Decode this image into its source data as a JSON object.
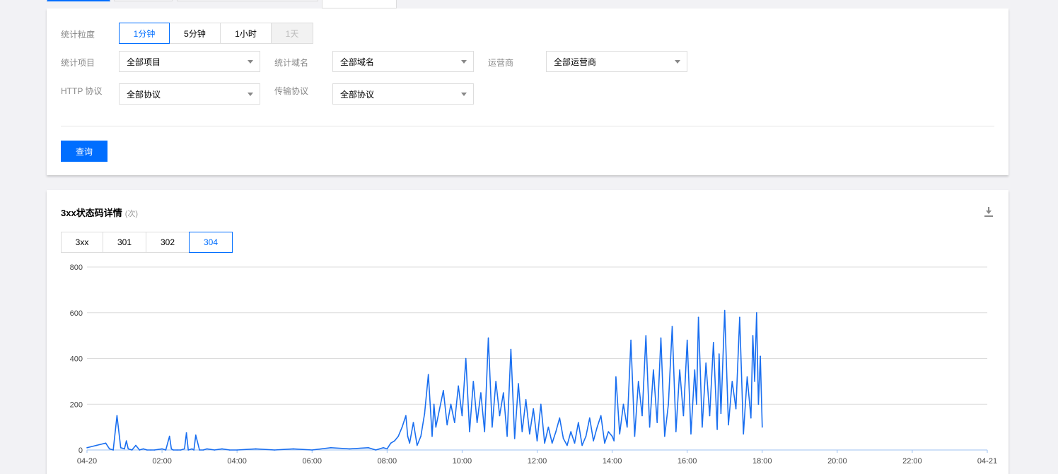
{
  "filters": {
    "granularity": {
      "label": "统计粒度",
      "options": [
        "1分钟",
        "5分钟",
        "1小时",
        "1天"
      ],
      "selected": "1分钟",
      "disabled": "1天"
    },
    "project": {
      "label": "统计项目",
      "value": "全部项目"
    },
    "domain": {
      "label": "统计域名",
      "value": "全部域名"
    },
    "isp": {
      "label": "运营商",
      "value": "全部运营商"
    },
    "http_protocol": {
      "label": "HTTP 协议",
      "value": "全部协议"
    },
    "transport_protocol": {
      "label": "传输协议",
      "value": "全部协议"
    },
    "query_button": "查询"
  },
  "chart_panel": {
    "title": "3xx状态码详情",
    "unit": "(次)",
    "tabs": [
      "3xx",
      "301",
      "302",
      "304"
    ],
    "active_tab": "304",
    "download_icon": "download-icon"
  },
  "colors": {
    "accent": "#006eff",
    "series": "#1a6ff0"
  },
  "chart_data": {
    "type": "line",
    "title": "3xx状态码详情",
    "xlabel": "",
    "ylabel": "",
    "ylim": [
      0,
      800
    ],
    "yticks": [
      "0",
      "200",
      "400",
      "600",
      "800"
    ],
    "xlim_hours": [
      0,
      24
    ],
    "xticks": [
      "04-20",
      "02:00",
      "04:00",
      "06:00",
      "08:00",
      "10:00",
      "12:00",
      "14:00",
      "16:00",
      "18:00",
      "20:00",
      "22:00",
      "04-21"
    ],
    "grid": true,
    "legend": "none",
    "series": [
      {
        "x_hours": [
          0.0,
          0.25,
          0.5,
          0.6,
          0.7,
          0.8,
          0.9,
          1.0,
          1.05,
          1.1,
          1.2,
          1.3,
          1.4,
          1.5,
          1.6,
          1.7,
          1.8,
          2.0,
          2.1,
          2.2,
          2.25,
          2.3,
          2.4,
          2.5,
          2.6,
          2.65,
          2.7,
          2.8,
          2.85,
          2.9,
          3.0,
          3.1,
          3.2,
          3.4,
          3.6,
          3.8,
          4.0,
          4.5,
          5.0,
          5.5,
          6.0,
          6.5,
          7.0,
          7.5,
          7.7,
          7.9,
          8.0,
          8.1,
          8.2,
          8.3,
          8.4,
          8.5,
          8.55,
          8.6,
          8.7,
          8.8,
          8.9,
          9.0,
          9.1,
          9.2,
          9.25,
          9.3,
          9.4,
          9.5,
          9.6,
          9.7,
          9.8,
          9.9,
          10.0,
          10.1,
          10.2,
          10.3,
          10.4,
          10.5,
          10.6,
          10.7,
          10.8,
          10.9,
          11.0,
          11.1,
          11.2,
          11.3,
          11.4,
          11.5,
          11.6,
          11.7,
          11.8,
          11.9,
          12.0,
          12.1,
          12.2,
          12.3,
          12.4,
          12.5,
          12.6,
          12.7,
          12.8,
          12.9,
          13.0,
          13.1,
          13.2,
          13.3,
          13.4,
          13.5,
          13.6,
          13.7,
          13.8,
          13.9,
          14.0,
          14.05,
          14.1,
          14.2,
          14.3,
          14.4,
          14.5,
          14.6,
          14.7,
          14.8,
          14.9,
          15.0,
          15.1,
          15.2,
          15.3,
          15.4,
          15.5,
          15.6,
          15.7,
          15.8,
          15.9,
          16.0,
          16.1,
          16.2,
          16.25,
          16.3,
          16.4,
          16.5,
          16.6,
          16.7,
          16.8,
          16.85,
          16.9,
          17.0,
          17.1,
          17.2,
          17.3,
          17.4,
          17.5,
          17.6,
          17.7,
          17.75,
          17.8,
          17.85,
          17.9,
          17.95,
          18.0
        ],
        "values": [
          10,
          20,
          30,
          5,
          0,
          150,
          10,
          5,
          40,
          5,
          0,
          20,
          0,
          5,
          0,
          0,
          0,
          5,
          0,
          60,
          5,
          0,
          0,
          0,
          5,
          75,
          0,
          5,
          0,
          65,
          0,
          0,
          5,
          0,
          5,
          0,
          0,
          5,
          0,
          5,
          0,
          10,
          5,
          10,
          0,
          10,
          5,
          30,
          40,
          60,
          100,
          150,
          60,
          30,
          120,
          20,
          60,
          160,
          330,
          60,
          200,
          100,
          180,
          260,
          110,
          200,
          120,
          280,
          150,
          400,
          80,
          300,
          120,
          250,
          80,
          490,
          100,
          300,
          150,
          250,
          60,
          440,
          50,
          290,
          80,
          220,
          70,
          180,
          40,
          200,
          30,
          100,
          30,
          80,
          140,
          50,
          20,
          80,
          30,
          120,
          20,
          60,
          140,
          40,
          100,
          150,
          30,
          80,
          60,
          40,
          320,
          70,
          200,
          100,
          480,
          60,
          300,
          150,
          500,
          100,
          350,
          120,
          490,
          60,
          200,
          540,
          80,
          350,
          150,
          480,
          70,
          350,
          200,
          580,
          100,
          380,
          150,
          470,
          90,
          420,
          160,
          610,
          110,
          300,
          180,
          580,
          70,
          320,
          140,
          500,
          300,
          600,
          200,
          410,
          100,
          400
        ]
      }
    ]
  }
}
